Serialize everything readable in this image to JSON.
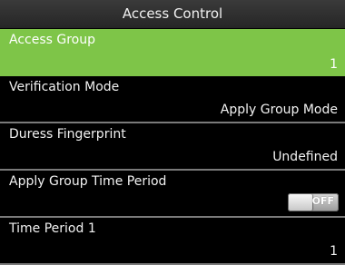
{
  "header": {
    "title": "Access Control"
  },
  "menu": {
    "items": [
      {
        "label": "Access Group",
        "value": "1"
      },
      {
        "label": "Verification Mode",
        "value": "Apply Group Mode"
      },
      {
        "label": "Duress Fingerprint",
        "value": "Undefined"
      },
      {
        "label": "Apply Group Time Period",
        "toggle_label": "OFF"
      },
      {
        "label": "Time Period 1",
        "value": "1"
      }
    ]
  },
  "colors": {
    "selected_background": "#7ec548",
    "screen_background": "#000000",
    "divider": "#7a7a7a"
  }
}
